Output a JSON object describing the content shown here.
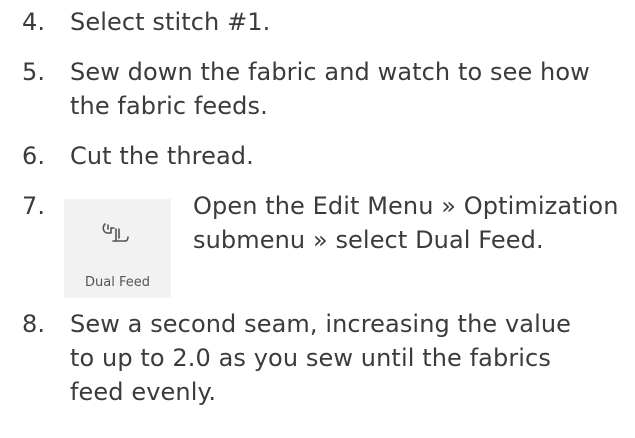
{
  "steps": [
    {
      "number": "4.",
      "lines": [
        "Select stitch #1."
      ]
    },
    {
      "number": "5.",
      "lines": [
        "Sew down the fabric and watch to see how",
        "the fabric feeds."
      ]
    },
    {
      "number": "6.",
      "lines": [
        "Cut the thread."
      ]
    },
    {
      "number": "7.",
      "lines": [
        "Open the Edit Menu » Optimization",
        "submenu » select Dual Feed."
      ]
    },
    {
      "number": "8.",
      "lines": [
        "Sew a second seam, increasing the value",
        "to up to 2.0 as you sew until the fabrics",
        "feed evenly."
      ]
    }
  ],
  "dual_feed_tile": {
    "label": "Dual Feed",
    "icon": "dual-feed-icon",
    "background": "#f2f2f2"
  },
  "colors": {
    "text": "#3b3b3b",
    "icon": "#555555"
  }
}
